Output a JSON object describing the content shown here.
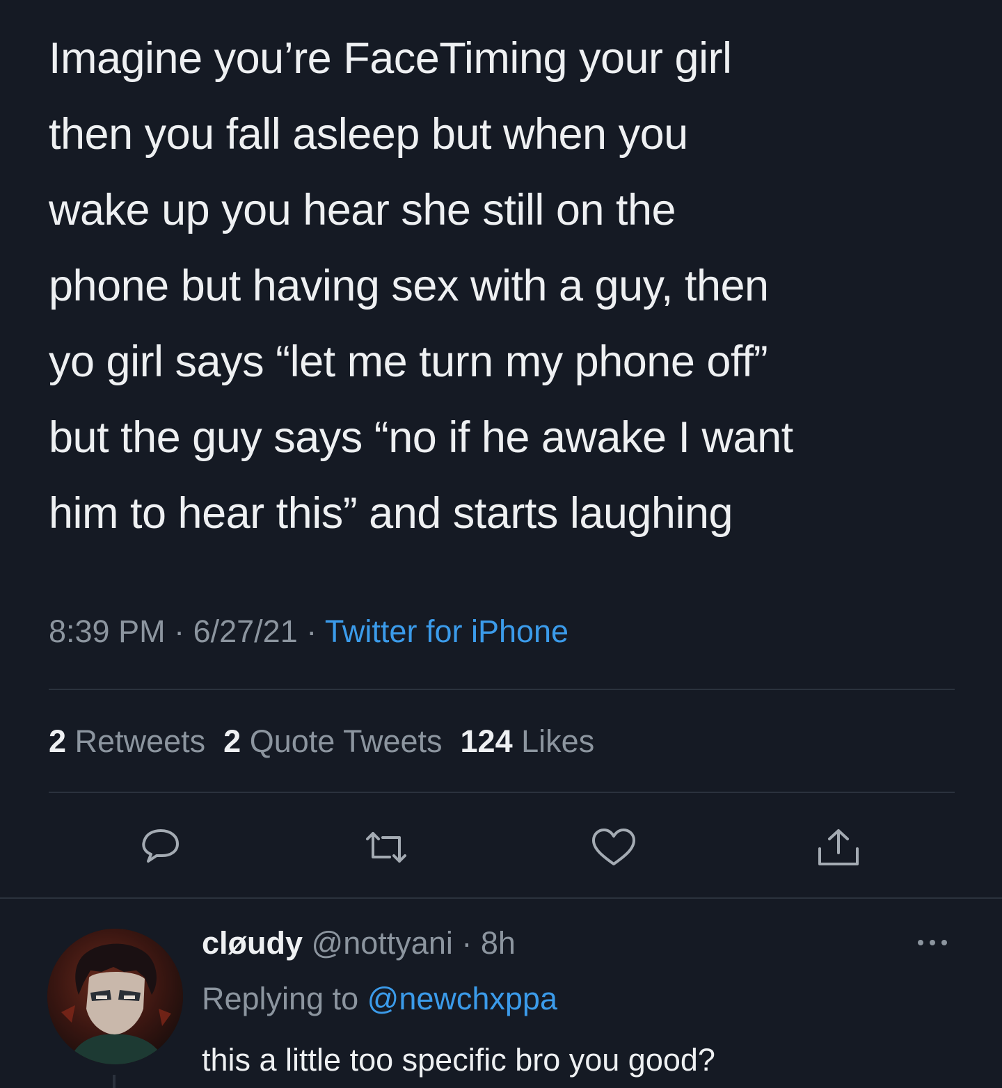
{
  "tweet": {
    "text": "Imagine you’re FaceTiming your girl\nthen you fall asleep but when you\nwake up you hear she still on the\nphone but having sex with a guy, then\nyo girl says “let me turn my phone off”\nbut the guy says “no if he awake I want\nhim to hear this” and starts laughing",
    "time": "8:39 PM",
    "sep": " · ",
    "date": "6/27/21",
    "source": "Twitter for iPhone"
  },
  "stats": {
    "retweets_count": "2",
    "retweets_label": "Retweets",
    "quotes_count": "2",
    "quotes_label": "Quote Tweets",
    "likes_count": "124",
    "likes_label": "Likes"
  },
  "actions": {
    "icons": [
      "reply-icon",
      "retweet-icon",
      "like-icon",
      "share-icon"
    ]
  },
  "reply": {
    "name": "cløudy",
    "handle": "@nottyani",
    "sep": " · ",
    "time": "8h",
    "replying_prefix": "Replying to ",
    "replying_to": "@newchxppa",
    "text": "this a little too specific bro you good?"
  },
  "colors": {
    "background": "#151a24",
    "text": "#eef0f2",
    "secondary": "#8c959f",
    "link": "#3b9bea"
  }
}
